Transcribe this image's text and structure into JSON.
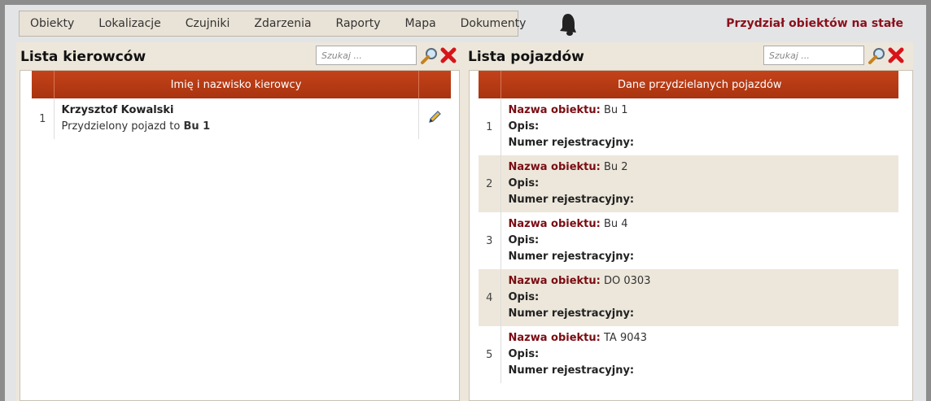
{
  "menu": [
    "Obiekty",
    "Lokalizacje",
    "Czujniki",
    "Zdarzenia",
    "Raporty",
    "Mapa",
    "Dokumenty"
  ],
  "header": {
    "title": "Przydział obiektów na stałe"
  },
  "drivers": {
    "title": "Lista kierowców",
    "search_placeholder": "Szukaj ...",
    "column": "Imię i nazwisko kierowcy",
    "rows": [
      {
        "num": "1",
        "name": "Krzysztof Kowalski",
        "assigned_prefix": "Przydzielony pojazd to",
        "assigned_vehicle": "Bu 1"
      }
    ]
  },
  "vehicles": {
    "title": "Lista pojazdów",
    "search_placeholder": "Szukaj ...",
    "column": "Dane przydzielanych pojazdów",
    "label_name": "Nazwa obiektu:",
    "label_desc": "Opis:",
    "label_reg": "Numer rejestracyjny:",
    "rows": [
      {
        "num": "1",
        "name": "Bu 1"
      },
      {
        "num": "2",
        "name": "Bu 2"
      },
      {
        "num": "3",
        "name": "Bu 4"
      },
      {
        "num": "4",
        "name": "DO 0303"
      },
      {
        "num": "5",
        "name": "TA 9043"
      }
    ]
  },
  "colors": {
    "accent": "#b63a14",
    "title_red": "#8b0f1a",
    "row_alt": "#ede7db"
  }
}
